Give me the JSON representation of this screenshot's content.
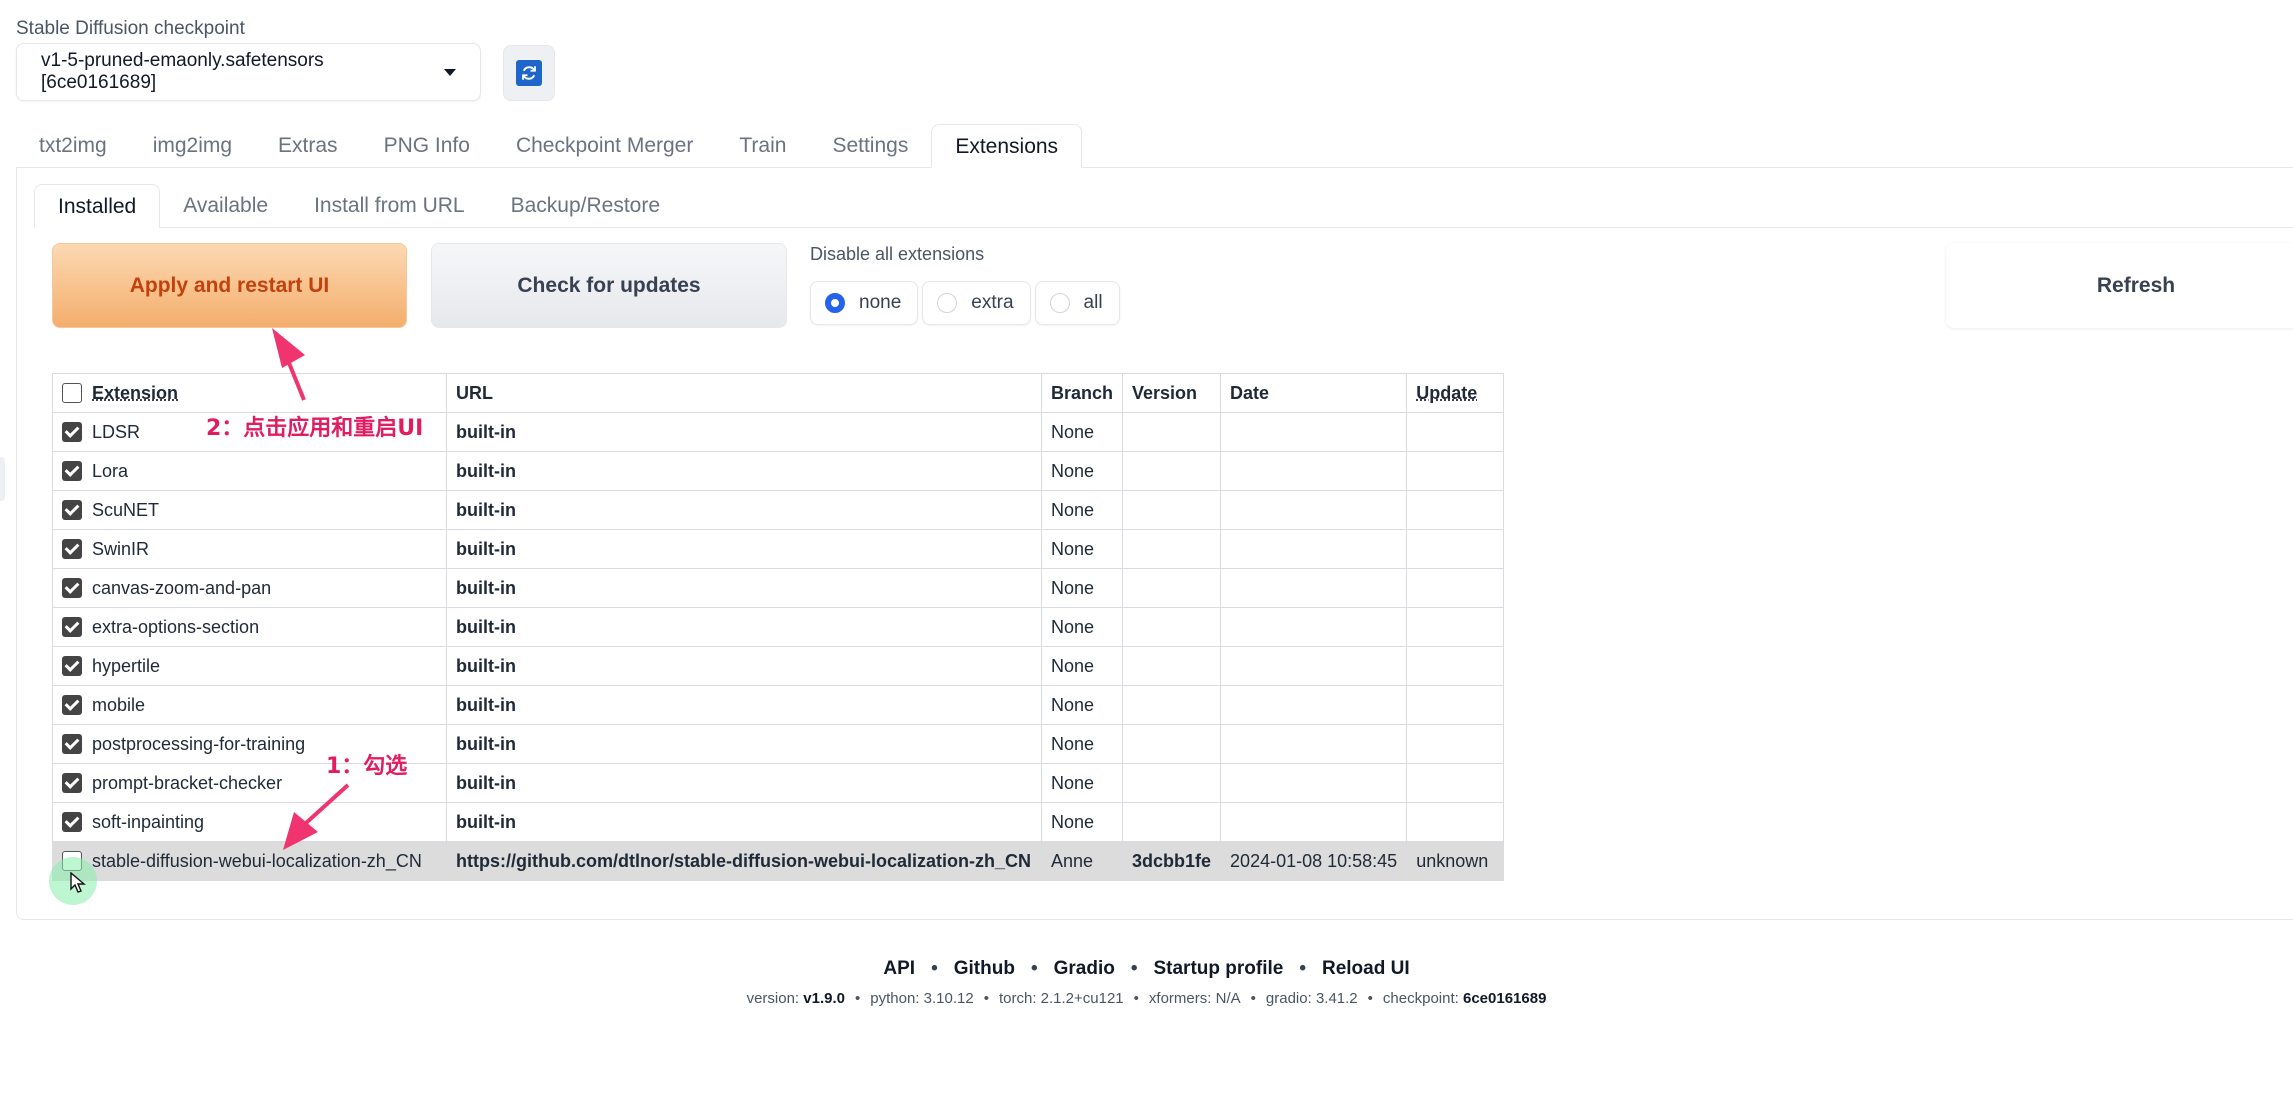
{
  "checkpoint": {
    "label": "Stable Diffusion checkpoint",
    "value": "v1-5-pruned-emaonly.safetensors [6ce0161689]"
  },
  "main_tabs": [
    "txt2img",
    "img2img",
    "Extras",
    "PNG Info",
    "Checkpoint Merger",
    "Train",
    "Settings",
    "Extensions"
  ],
  "sub_tabs": [
    "Installed",
    "Available",
    "Install from URL",
    "Backup/Restore"
  ],
  "buttons": {
    "apply": "Apply and restart UI",
    "check": "Check for updates",
    "refresh": "Refresh"
  },
  "disable": {
    "label": "Disable all extensions",
    "options": [
      "none",
      "extra",
      "all"
    ],
    "selected": "none"
  },
  "table": {
    "headers": [
      "Extension",
      "URL",
      "Branch",
      "Version",
      "Date",
      "Update"
    ],
    "rows": [
      {
        "name": "LDSR",
        "url": "built-in",
        "branch": "None",
        "version": "",
        "date": "",
        "update": "",
        "checked": true
      },
      {
        "name": "Lora",
        "url": "built-in",
        "branch": "None",
        "version": "",
        "date": "",
        "update": "",
        "checked": true
      },
      {
        "name": "ScuNET",
        "url": "built-in",
        "branch": "None",
        "version": "",
        "date": "",
        "update": "",
        "checked": true
      },
      {
        "name": "SwinIR",
        "url": "built-in",
        "branch": "None",
        "version": "",
        "date": "",
        "update": "",
        "checked": true
      },
      {
        "name": "canvas-zoom-and-pan",
        "url": "built-in",
        "branch": "None",
        "version": "",
        "date": "",
        "update": "",
        "checked": true
      },
      {
        "name": "extra-options-section",
        "url": "built-in",
        "branch": "None",
        "version": "",
        "date": "",
        "update": "",
        "checked": true
      },
      {
        "name": "hypertile",
        "url": "built-in",
        "branch": "None",
        "version": "",
        "date": "",
        "update": "",
        "checked": true
      },
      {
        "name": "mobile",
        "url": "built-in",
        "branch": "None",
        "version": "",
        "date": "",
        "update": "",
        "checked": true
      },
      {
        "name": "postprocessing-for-training",
        "url": "built-in",
        "branch": "None",
        "version": "",
        "date": "",
        "update": "",
        "checked": true
      },
      {
        "name": "prompt-bracket-checker",
        "url": "built-in",
        "branch": "None",
        "version": "",
        "date": "",
        "update": "",
        "checked": true
      },
      {
        "name": "soft-inpainting",
        "url": "built-in",
        "branch": "None",
        "version": "",
        "date": "",
        "update": "",
        "checked": true
      },
      {
        "name": "stable-diffusion-webui-localization-zh_CN",
        "url": "https://github.com/dtlnor/stable-diffusion-webui-localization-zh_CN",
        "branch": "Anne",
        "version": "3dcbb1fe",
        "date": "2024-01-08 10:58:45",
        "update": "unknown",
        "checked": false
      }
    ]
  },
  "annotations": {
    "step1": "1：勾选",
    "step2": "2：点击应用和重启UI"
  },
  "footer": {
    "links": [
      "API",
      "Github",
      "Gradio",
      "Startup profile",
      "Reload UI"
    ],
    "version_label": "version:",
    "version": "v1.9.0",
    "python_label": "python:",
    "python": "3.10.12",
    "torch_label": "torch:",
    "torch": "2.1.2+cu121",
    "xformers_label": "xformers:",
    "xformers": "N/A",
    "gradio_label": "gradio:",
    "gradio": "3.41.2",
    "checkpoint_label": "checkpoint:",
    "checkpoint": "6ce0161689"
  },
  "colors": {
    "accent": "#2563eb",
    "apply_text": "#c2410c",
    "annotation": "#e11d62",
    "refresh_icon": "#1e66c9"
  }
}
